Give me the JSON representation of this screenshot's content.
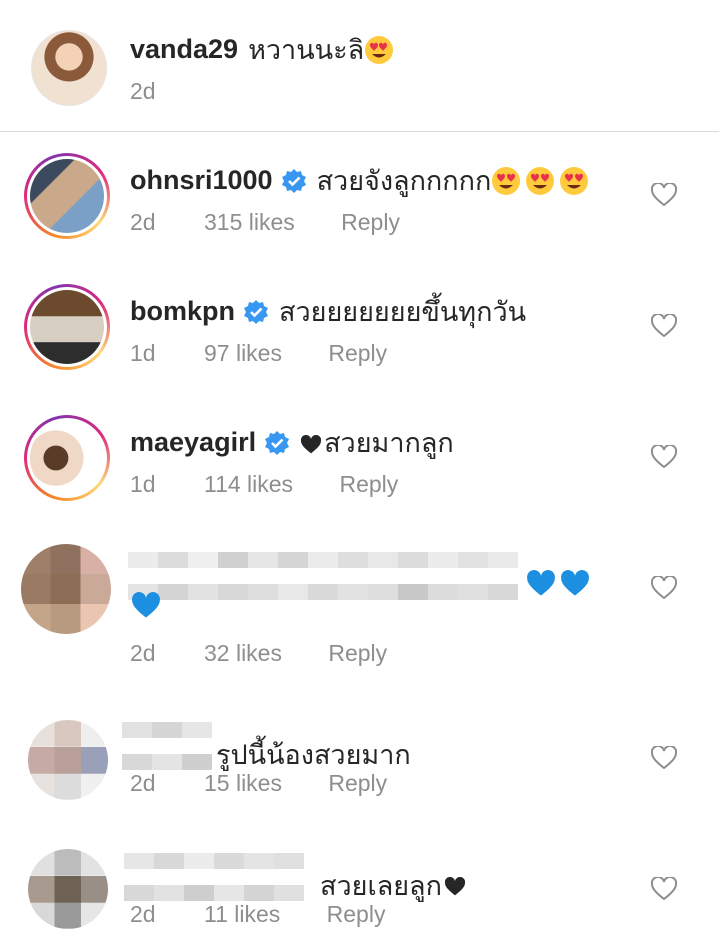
{
  "caption": {
    "username": "vanda29",
    "text": "หวานนะลิ",
    "time": "2d"
  },
  "comments": [
    {
      "username": "ohnsri1000",
      "text": "สวยจังลูกกกกก",
      "time": "2d",
      "likes": "315 likes",
      "reply": "Reply"
    },
    {
      "username": "bomkpn",
      "text": "สวยยยยยยยขึ้นทุกวัน",
      "time": "1d",
      "likes": "97 likes",
      "reply": "Reply"
    },
    {
      "username": "maeyagirl",
      "text": "สวยมากลูก",
      "time": "1d",
      "likes": "114 likes",
      "reply": "Reply"
    },
    {
      "username": "",
      "text": "",
      "time": "2d",
      "likes": "32 likes",
      "reply": "Reply"
    },
    {
      "username": "",
      "text": "รูปนี้น้องสวยมาก",
      "time": "2d",
      "likes": "15 likes",
      "reply": "Reply"
    },
    {
      "username": "",
      "text": "สวยเลยลูก",
      "time": "2d",
      "likes": "11 likes",
      "reply": "Reply"
    }
  ],
  "icons": {
    "verified": "verified-badge-icon",
    "like": "heart-outline-icon",
    "emoji": "heart-eyes-emoji",
    "blue_heart": "blue-heart-emoji",
    "black_heart": "black-heart-symbol"
  },
  "colors": {
    "text": "#262626",
    "secondary": "#8e8e8e",
    "verified": "#3897f0",
    "divider": "#dbdbdb",
    "blue_heart": "#1d8fe0"
  }
}
